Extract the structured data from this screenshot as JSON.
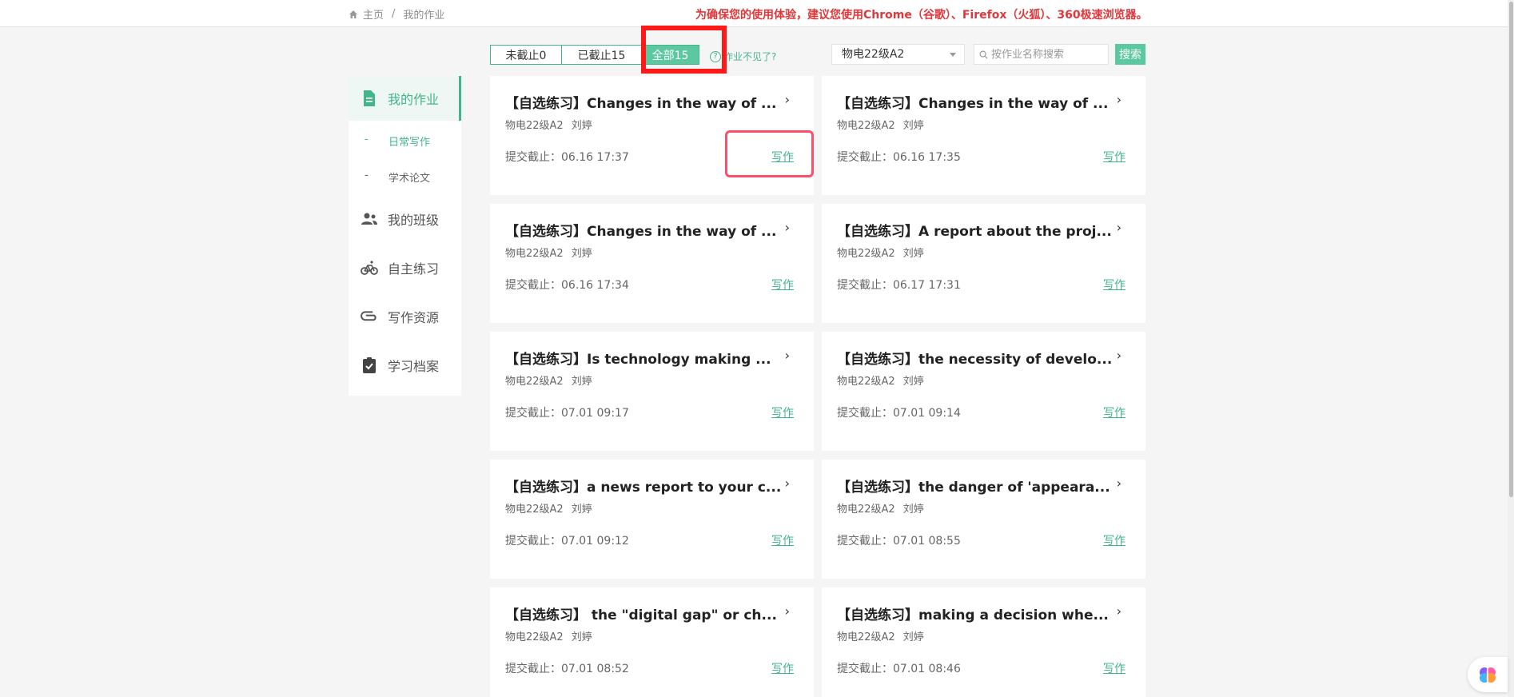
{
  "breadcrumb": {
    "home": "主页",
    "sep": "/",
    "current": "我的作业"
  },
  "notice": "为确保您的使用体验，建议您使用Chrome（谷歌）、Firefox（火狐）、360极速浏览器。",
  "sidebar": {
    "items": [
      {
        "label": "我的作业",
        "icon": "document-icon",
        "active": true
      },
      {
        "label": "我的班级",
        "icon": "users-icon"
      },
      {
        "label": "自主练习",
        "icon": "bicycle-icon"
      },
      {
        "label": "写作资源",
        "icon": "paperclip-icon"
      },
      {
        "label": "学习档案",
        "icon": "clipboard-check-icon"
      }
    ],
    "subitems": [
      {
        "dash": "-",
        "label": "日常写作",
        "active": true
      },
      {
        "dash": "-",
        "label": "学术论文"
      }
    ]
  },
  "filters": {
    "tabs": [
      {
        "label": "未截止0"
      },
      {
        "label": "已截止15"
      },
      {
        "label": "全部15",
        "active": true
      }
    ],
    "help_text": "作业不见了?",
    "help_icon": "question-circle-icon",
    "class_select": "物电22级A2",
    "search_placeholder": "按作业名称搜索",
    "search_button": "搜索"
  },
  "cards": [
    {
      "title": "【自选练习】Changes in the way of ...",
      "class": "物电22级A2",
      "teacher": "刘婷",
      "due": "提交截止：06.16 17:37",
      "action": "写作",
      "chevron": "›"
    },
    {
      "title": "【自选练习】Changes in the way of ...",
      "class": "物电22级A2",
      "teacher": "刘婷",
      "due": "提交截止：06.16 17:35",
      "action": "写作",
      "chevron": "›"
    },
    {
      "title": "【自选练习】Changes in the way of ...",
      "class": "物电22级A2",
      "teacher": "刘婷",
      "due": "提交截止：06.16 17:34",
      "action": "写作",
      "chevron": "›"
    },
    {
      "title": "【自选练习】A report about the proj...",
      "class": "物电22级A2",
      "teacher": "刘婷",
      "due": "提交截止：06.17 17:31",
      "action": "写作",
      "chevron": "›"
    },
    {
      "title": "【自选练习】Is technology making ...",
      "class": "物电22级A2",
      "teacher": "刘婷",
      "due": "提交截止：07.01 09:17",
      "action": "写作",
      "chevron": "›"
    },
    {
      "title": "【自选练习】the necessity of develo...",
      "class": "物电22级A2",
      "teacher": "刘婷",
      "due": "提交截止：07.01 09:14",
      "action": "写作",
      "chevron": "›"
    },
    {
      "title": "【自选练习】a news report to your c...",
      "class": "物电22级A2",
      "teacher": "刘婷",
      "due": "提交截止：07.01 09:12",
      "action": "写作",
      "chevron": "›"
    },
    {
      "title": "【自选练习】the danger of 'appeara...",
      "class": "物电22级A2",
      "teacher": "刘婷",
      "due": "提交截止：07.01 08:55",
      "action": "写作",
      "chevron": "›"
    },
    {
      "title": "【自选练习】 the \"digital gap\" or ch...",
      "class": "物电22级A2",
      "teacher": "刘婷",
      "due": "提交截止：07.01 08:52",
      "action": "写作",
      "chevron": "›"
    },
    {
      "title": "【自选练习】making a decision whe...",
      "class": "物电22级A2",
      "teacher": "刘婷",
      "due": "提交截止：07.01 08:46",
      "action": "写作",
      "chevron": "›"
    }
  ],
  "colors": {
    "accent": "#43b58a",
    "accent_fill": "#5cc8a0",
    "notice": "#e0373a",
    "highlight": "#ff1a1a"
  }
}
